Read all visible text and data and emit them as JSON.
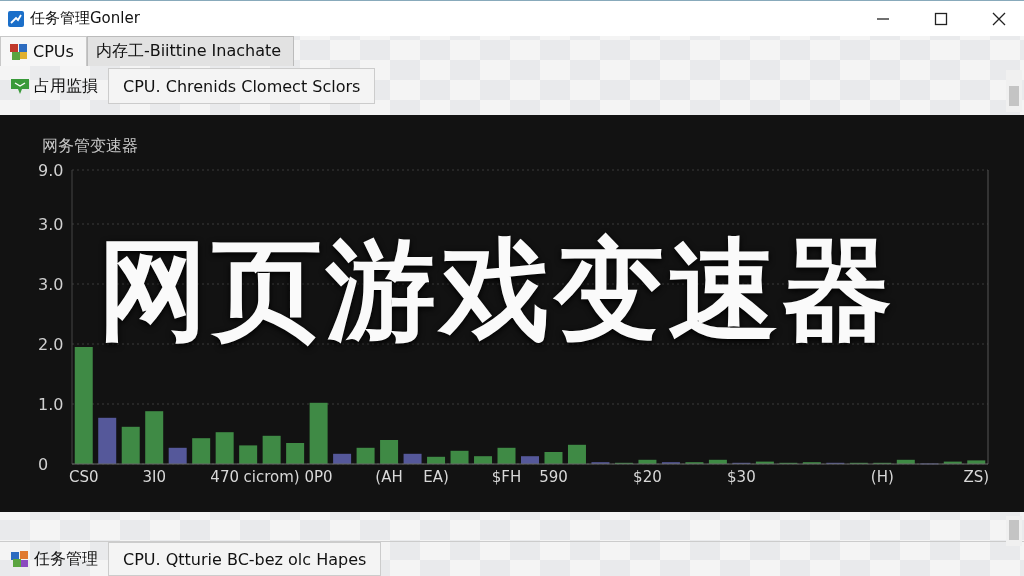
{
  "window": {
    "title": "任务管理Gonler"
  },
  "tabs": [
    {
      "label": "CPUs",
      "selected": true
    },
    {
      "label": "内存工-Biittine Inachate",
      "selected": false
    }
  ],
  "toolbar": {
    "label": "占用监損",
    "button": "CPU. Chrenids Clomect Sclors"
  },
  "panel": {
    "overlay_title": "网页游戏变速器",
    "chart_title": "网务管变速器",
    "y_axis_labels": [
      "9.0",
      "3.0",
      "3.0",
      "2.0",
      "1.0",
      "0"
    ],
    "x_axis_labels": [
      "CS0",
      "3I0",
      "470",
      "cicrom)",
      "0P0",
      "(AH",
      "EA)",
      "$FH",
      "590",
      "$20",
      "$30",
      "(H)",
      "ZS)"
    ]
  },
  "bottom_bar": {
    "label": "任务管理",
    "tab": "CPU. Qtturie BC-bez olc Hapes"
  }
}
